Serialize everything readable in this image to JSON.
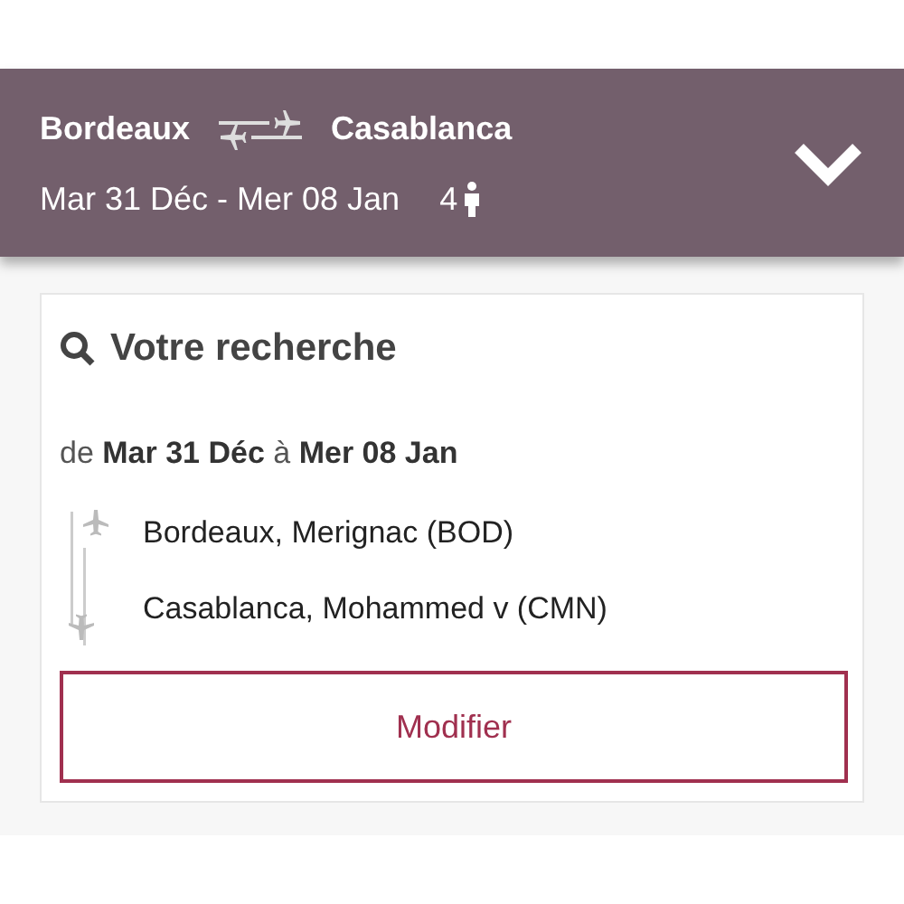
{
  "header": {
    "origin": "Bordeaux",
    "destination": "Casablanca",
    "dates": "Mar 31 Déc - Mer 08 Jan",
    "passengers": "4",
    "expanded": false
  },
  "search": {
    "title": "Votre recherche",
    "dates": "de **Mar 31 Déc** à **Mer 08 Jan**",
    "stops": [
      {
        "kind": "departure",
        "label": "Bordeaux, Merignac (BOD)"
      },
      {
        "kind": "arrival",
        "label": "Casablanca, Mohammed v (CMN)"
      }
    ],
    "button": "Modifier"
  }
}
